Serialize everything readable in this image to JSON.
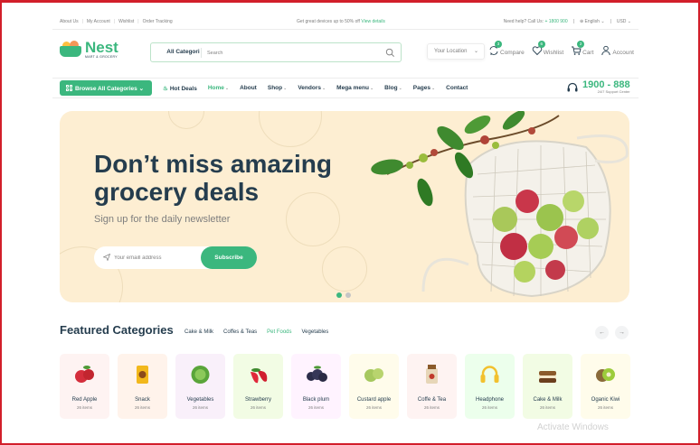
{
  "topbar": {
    "links": [
      "About Us",
      "My Account",
      "Wishlist",
      "Order Tracking"
    ],
    "promo_prefix": "Get great devices up to 50% off",
    "promo_link": "View details",
    "help_prefix": "Need help? Call Us:",
    "help_phone": "+ 1800 900",
    "language": "English",
    "currency": "USD"
  },
  "header": {
    "logo_name": "Nest",
    "logo_tagline": "MART & GROCERY",
    "search_category": "All Categori",
    "search_placeholder": "Search",
    "location_label": "Your Location",
    "compare_label": "Compare",
    "compare_count": "3",
    "wishlist_label": "Wishlist",
    "wishlist_count": "6",
    "cart_label": "Cart",
    "cart_count": "2",
    "account_label": "Account"
  },
  "nav": {
    "browse_label": "Browse All Categories",
    "hot_deals": "Hot Deals",
    "items": [
      {
        "label": "Home",
        "dropdown": "true"
      },
      {
        "label": "About",
        "dropdown": ""
      },
      {
        "label": "Shop",
        "dropdown": "true"
      },
      {
        "label": "Vendors",
        "dropdown": "true"
      },
      {
        "label": "Mega menu",
        "dropdown": "true"
      },
      {
        "label": "Blog",
        "dropdown": "true"
      },
      {
        "label": "Pages",
        "dropdown": "true"
      },
      {
        "label": "Contact",
        "dropdown": ""
      }
    ],
    "support_phone": "1900 - 888",
    "support_label": "24/7 Support Center"
  },
  "hero": {
    "title_line1": "Don’t miss amazing",
    "title_line2": "grocery deals",
    "subtitle": "Sign up for the daily newsletter",
    "email_placeholder": "Your emaill address",
    "subscribe_label": "Subscribe",
    "active_slide": 1,
    "slides": 2
  },
  "featured": {
    "title": "Featured Categories",
    "tabs": [
      "Cake & Milk",
      "Coffes & Teas",
      "Pet Foods",
      "Vegetables"
    ],
    "active_tab": "Pet Foods",
    "categories": [
      {
        "name": "Red Apple",
        "count": "26 items",
        "bg": "#fef3f2",
        "icon": "red-apple-icon"
      },
      {
        "name": "Snack",
        "count": "26 items",
        "bg": "#fff3eb",
        "icon": "snack-icon"
      },
      {
        "name": "Vegetables",
        "count": "26 items",
        "bg": "#f9f0fa",
        "icon": "cabbage-icon"
      },
      {
        "name": "Strawberry",
        "count": "26 items",
        "bg": "#f2fce4",
        "icon": "strawberry-icon"
      },
      {
        "name": "Black plum",
        "count": "26 items",
        "bg": "#fff3ff",
        "icon": "black-plum-icon"
      },
      {
        "name": "Custard apple",
        "count": "26 items",
        "bg": "#fffceb",
        "icon": "custard-apple-icon"
      },
      {
        "name": "Coffe & Tea",
        "count": "26 items",
        "bg": "#fef3f2",
        "icon": "coffee-tea-icon"
      },
      {
        "name": "Headphone",
        "count": "26 items",
        "bg": "#ecffec",
        "icon": "headphone-icon"
      },
      {
        "name": "Cake & Milk",
        "count": "26 items",
        "bg": "#f2fce4",
        "icon": "cake-milk-icon"
      },
      {
        "name": "Oganic Kiwi",
        "count": "26 items",
        "bg": "#fffceb",
        "icon": "kiwi-icon"
      }
    ]
  },
  "colors": {
    "brand": "#3bb77e",
    "heading": "#253d4e",
    "hero_bg": "#fdeed2",
    "frame": "#d21f2a"
  },
  "watermark": "Activate Windows"
}
